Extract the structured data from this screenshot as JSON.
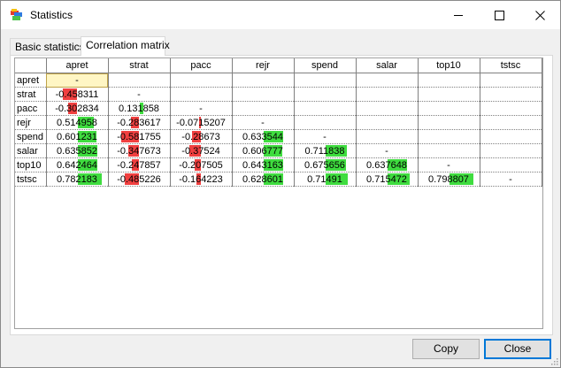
{
  "window": {
    "title": "Statistics"
  },
  "tabs": [
    {
      "label": "Basic statistics",
      "active": false
    },
    {
      "label": "Correlation matrix",
      "active": true
    }
  ],
  "matrix": {
    "columns": [
      "apret",
      "strat",
      "pacc",
      "rejr",
      "spend",
      "salar",
      "top10",
      "tstsc"
    ],
    "rows": [
      {
        "label": "apret",
        "cells": [
          "-",
          "",
          "",
          "",
          "",
          "",
          "",
          ""
        ]
      },
      {
        "label": "strat",
        "cells": [
          "-0.458311",
          "-",
          "",
          "",
          "",
          "",
          "",
          ""
        ]
      },
      {
        "label": "pacc",
        "cells": [
          "-0.302834",
          "0.131858",
          "-",
          "",
          "",
          "",
          "",
          ""
        ]
      },
      {
        "label": "rejr",
        "cells": [
          "0.514958",
          "-0.283617",
          "-0.0715207",
          "-",
          "",
          "",
          "",
          ""
        ]
      },
      {
        "label": "spend",
        "cells": [
          "0.601231",
          "-0.581755",
          "-0.28673",
          "0.633544",
          "-",
          "",
          "",
          ""
        ]
      },
      {
        "label": "salar",
        "cells": [
          "0.635852",
          "-0.347673",
          "-0.37524",
          "0.606777",
          "0.711838",
          "-",
          "",
          ""
        ]
      },
      {
        "label": "top10",
        "cells": [
          "0.642464",
          "-0.247857",
          "-0.207505",
          "0.643163",
          "0.675656",
          "0.637648",
          "-",
          ""
        ]
      },
      {
        "label": "tstsc",
        "cells": [
          "0.782183",
          "-0.485226",
          "-0.164223",
          "0.628601",
          "0.71491",
          "0.715472",
          "0.798807",
          "-"
        ]
      }
    ],
    "positive_color": "#3fdc3f",
    "negative_color": "#f04040",
    "selected_color": "#fff6c4"
  },
  "buttons": {
    "copy": "Copy",
    "close": "Close"
  }
}
